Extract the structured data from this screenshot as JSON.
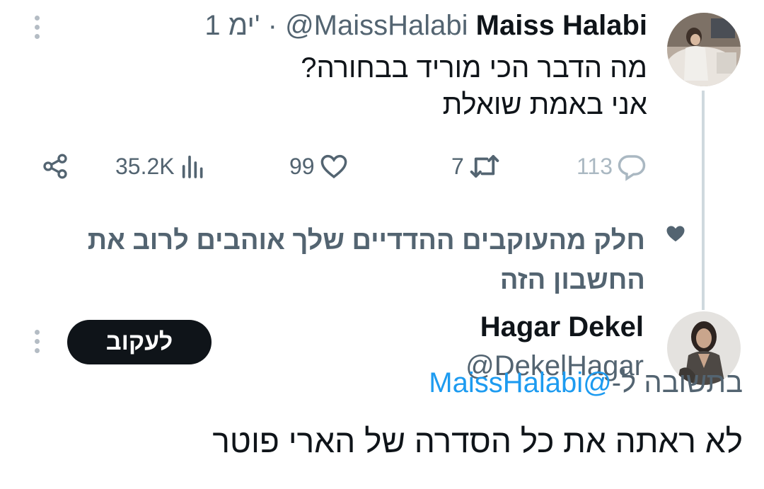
{
  "tweet": {
    "author_name": "Maiss Halabi",
    "handle": "@MaissHalabi",
    "separator": "·",
    "time": "1 ימ'",
    "text_lines": [
      "מה הדבר הכי מוריד בבחורה?",
      "אני באמת שואלת"
    ],
    "actions": {
      "replies": "113",
      "reposts": "7",
      "likes": "99",
      "views": "35.2K"
    }
  },
  "social_context": {
    "text": "חלק מהעוקבים ההדדיים שלך אוהבים לרוב את החשבון הזה"
  },
  "reply": {
    "author_name": "Hagar Dekel",
    "handle": "@DekelHagar",
    "follow_label": "לעקוב",
    "replying_to_prefix": "בתשובה ל-",
    "replying_to_handle": "@MaissHalabi",
    "text": "לא ראתה את כל הסדרה של הארי פוטר"
  },
  "colors": {
    "text_primary": "#0f1419",
    "text_secondary": "#536471",
    "link": "#1d9bf0",
    "thread_line": "#cfd9de"
  }
}
